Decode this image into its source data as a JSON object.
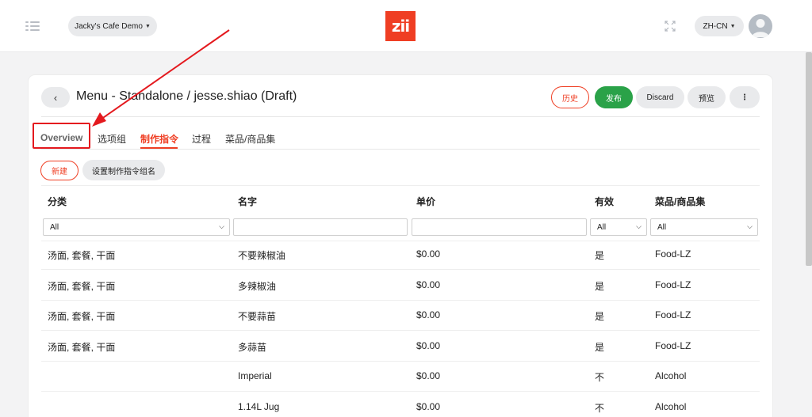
{
  "header": {
    "store_name": "Jacky's Cafe Demo",
    "logo_text": "zii",
    "language": "ZH-CN",
    "icons": {
      "menu": "menu-lines-icon",
      "expand": "fullscreen-icon",
      "avatar": "user-avatar-icon"
    }
  },
  "page": {
    "back_label": "‹",
    "title": "Menu - Standalone / jesse.shiao (Draft)",
    "actions": {
      "history": "历史",
      "publish": "发布",
      "discard": "Discard",
      "preview": "预览",
      "more": "⋮"
    },
    "tabs": [
      {
        "label": "Overview"
      },
      {
        "label": "选项组"
      },
      {
        "label": "制作指令"
      },
      {
        "label": "过程"
      },
      {
        "label": "菜品/商品集"
      }
    ],
    "toolbar": {
      "new_label": "新建",
      "set_name_label": "设置制作指令组名"
    }
  },
  "table": {
    "columns": [
      "分类",
      "名字",
      "单价",
      "有效",
      "菜品/商品集"
    ],
    "filters": {
      "category": "All",
      "name": "",
      "price": "",
      "valid": "All",
      "collection": "All"
    },
    "rows": [
      {
        "category": "汤面, 套餐, 干面",
        "name": "不要辣椒油",
        "price": "$0.00",
        "valid": "是",
        "collection": "Food-LZ"
      },
      {
        "category": "汤面, 套餐, 干面",
        "name": "多辣椒油",
        "price": "$0.00",
        "valid": "是",
        "collection": "Food-LZ"
      },
      {
        "category": "汤面, 套餐, 干面",
        "name": "不要蒜苗",
        "price": "$0.00",
        "valid": "是",
        "collection": "Food-LZ"
      },
      {
        "category": "汤面, 套餐, 干面",
        "name": "多蒜苗",
        "price": "$0.00",
        "valid": "是",
        "collection": "Food-LZ"
      },
      {
        "category": "",
        "name": "Imperial",
        "price": "$0.00",
        "valid": "不",
        "collection": "Alcohol"
      },
      {
        "category": "",
        "name": "1.14L Jug",
        "price": "$0.00",
        "valid": "不",
        "collection": "Alcohol"
      }
    ]
  },
  "colors": {
    "brand": "#ef3e23",
    "publish": "#2aa248",
    "annotation": "#e4191e"
  }
}
